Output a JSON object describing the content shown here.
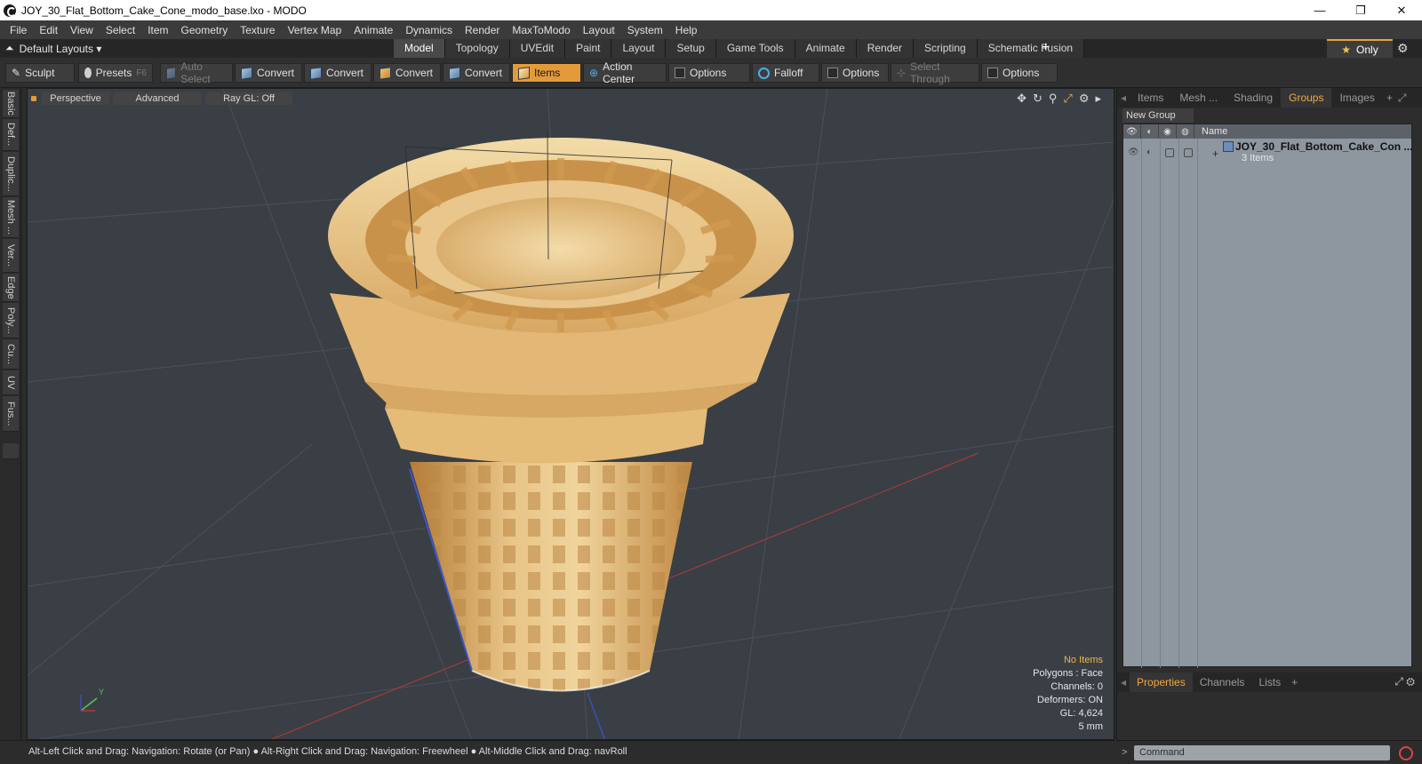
{
  "window": {
    "title": "JOY_30_Flat_Bottom_Cake_Cone_modo_base.lxo - MODO",
    "controls": [
      "—",
      "❐",
      "✕"
    ]
  },
  "menu": [
    "File",
    "Edit",
    "View",
    "Select",
    "Item",
    "Geometry",
    "Texture",
    "Vertex Map",
    "Animate",
    "Dynamics",
    "Render",
    "MaxToModo",
    "Layout",
    "System",
    "Help"
  ],
  "layouts": {
    "label": "Default Layouts ▾"
  },
  "layout_tabs": [
    "Model",
    "Topology",
    "UVEdit",
    "Paint",
    "Layout",
    "Setup",
    "Game Tools",
    "Animate",
    "Render",
    "Scripting",
    "Schematic Fusion"
  ],
  "only_label": "Only",
  "toolbar": {
    "sculpt": "Sculpt",
    "presets": "Presets",
    "presets_key": "F6",
    "auto_select": "Auto Select",
    "convert1": "Convert",
    "convert2": "Convert",
    "convert3": "Convert",
    "convert4": "Convert",
    "items": "Items",
    "action_center": "Action Center",
    "options1": "Options",
    "falloff": "Falloff",
    "options2": "Options",
    "select_through": "Select Through",
    "options3": "Options"
  },
  "left_tabs": [
    "Basic",
    "Def...",
    "Duplic...",
    "Mesh ...",
    "Ver...",
    "Edge",
    "Poly...",
    "Cu...",
    "UV",
    "Fus..."
  ],
  "viewport": {
    "view": "Perspective",
    "shading": "Advanced",
    "raygl": "Ray GL: Off",
    "stats": {
      "selection": "No Items",
      "polygons": "Polygons : Face",
      "channels": "Channels: 0",
      "deformers": "Deformers: ON",
      "gl": "GL: 4,624",
      "scale": "5 mm"
    }
  },
  "right_panel": {
    "tabs": [
      "Items",
      "Mesh ...",
      "Shading",
      "Groups",
      "Images"
    ],
    "active_tab": "Groups",
    "new_group": "New Group",
    "column_name": "Name",
    "group": {
      "name": "JOY_30_Flat_Bottom_Cake_Con ...",
      "count": "3 Items"
    },
    "bottom_tabs": [
      "Properties",
      "Channels",
      "Lists"
    ]
  },
  "status_bar": "Alt-Left Click and Drag: Navigation: Rotate (or Pan) ● Alt-Right Click and Drag: Navigation: Freewheel ● Alt-Middle Click and Drag: navRoll",
  "command": {
    "placeholder": "Command"
  },
  "colors": {
    "accent": "#e39a3a",
    "cone_light": "#f1d29a",
    "cone_dark": "#c98f45",
    "viewport_bg": "#3a3f45"
  }
}
